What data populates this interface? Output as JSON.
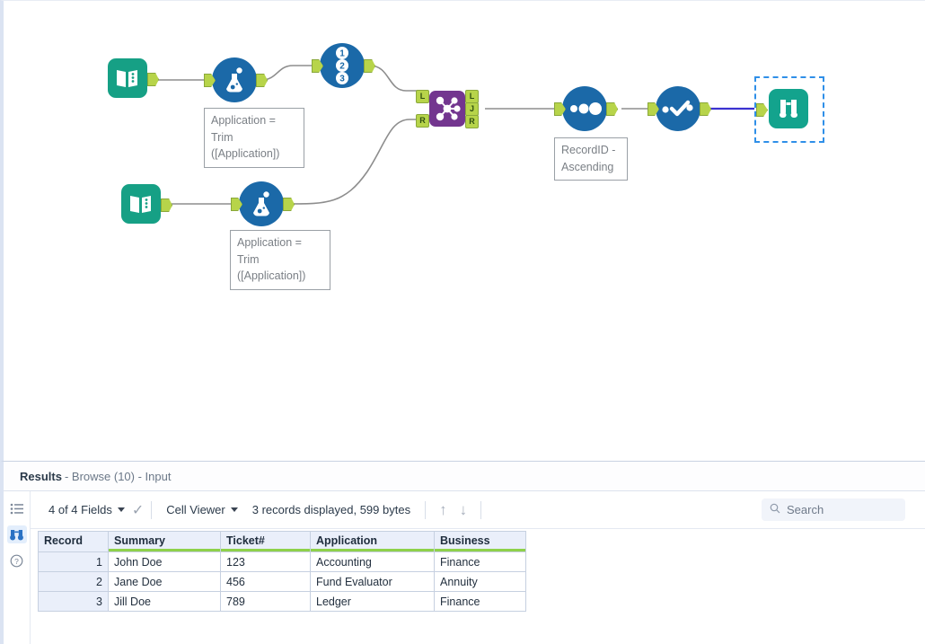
{
  "canvas": {
    "tools": [
      {
        "id": "input-1",
        "type": "input-tool",
        "icon": "book-icon"
      },
      {
        "id": "formula-1",
        "type": "formula-tool",
        "icon": "flask-icon"
      },
      {
        "id": "recordid-1",
        "type": "record-id-tool",
        "icon": "numbers-123-icon"
      },
      {
        "id": "join-1",
        "type": "join-tool",
        "icon": "join-node-icon"
      },
      {
        "id": "sort-1",
        "type": "sort-tool",
        "icon": "three-dots-icon"
      },
      {
        "id": "select-1",
        "type": "select-tool",
        "icon": "checkmark-icon"
      },
      {
        "id": "browse-1",
        "type": "browse-tool",
        "icon": "binoculars-icon"
      },
      {
        "id": "input-2",
        "type": "input-tool",
        "icon": "book-icon"
      },
      {
        "id": "formula-2",
        "type": "formula-tool",
        "icon": "flask-icon"
      }
    ],
    "annotations": {
      "formula_1": "Application =\nTrim\n([Application])",
      "formula_2": "Application =\nTrim\n([Application])",
      "sort_1": "RecordID -\nAscending"
    },
    "join_ports": {
      "in_left": "L",
      "in_right": "R",
      "out_left": "L",
      "out_join": "J",
      "out_right": "R"
    },
    "record_id_digits": [
      "1",
      "2",
      "3"
    ],
    "colors": {
      "input_tool": "#16a085",
      "browse_tool": "#13a38d",
      "round_tool": "#1b69a8",
      "join_tool": "#73368f",
      "port": "#b7d44a",
      "wire": "#8d8d8d",
      "selected_wire": "#3b32d0",
      "selection_border": "#2f8fe8"
    }
  },
  "results": {
    "title_bold": "Results",
    "title_sub": "- Browse (10) - Input",
    "rail": [
      {
        "name": "list-icon",
        "glyph": "≡",
        "active": false
      },
      {
        "name": "binoculars-icon",
        "glyph": "🔭",
        "active": true
      },
      {
        "name": "help-icon",
        "glyph": "?",
        "active": false
      }
    ],
    "toolbar": {
      "fields_label": "4 of 4 Fields",
      "check_icon": "✓",
      "viewer_label": "Cell Viewer",
      "record_status": "3 records displayed, 599 bytes",
      "arrow_up": "↑",
      "arrow_down": "↓"
    },
    "search": {
      "icon": "search-icon",
      "placeholder": "Search"
    },
    "table": {
      "columns": [
        "Record",
        "Summary",
        "Ticket#",
        "Application",
        "Business"
      ],
      "rows": [
        {
          "record": "1",
          "summary": "John Doe",
          "ticket": "123",
          "application": "Accounting",
          "business": "Finance"
        },
        {
          "record": "2",
          "summary": "Jane Doe",
          "ticket": "456",
          "application": "Fund Evaluator",
          "business": "Annuity"
        },
        {
          "record": "3",
          "summary": "Jill Doe",
          "ticket": "789",
          "application": "Ledger",
          "business": "Finance"
        }
      ]
    }
  }
}
